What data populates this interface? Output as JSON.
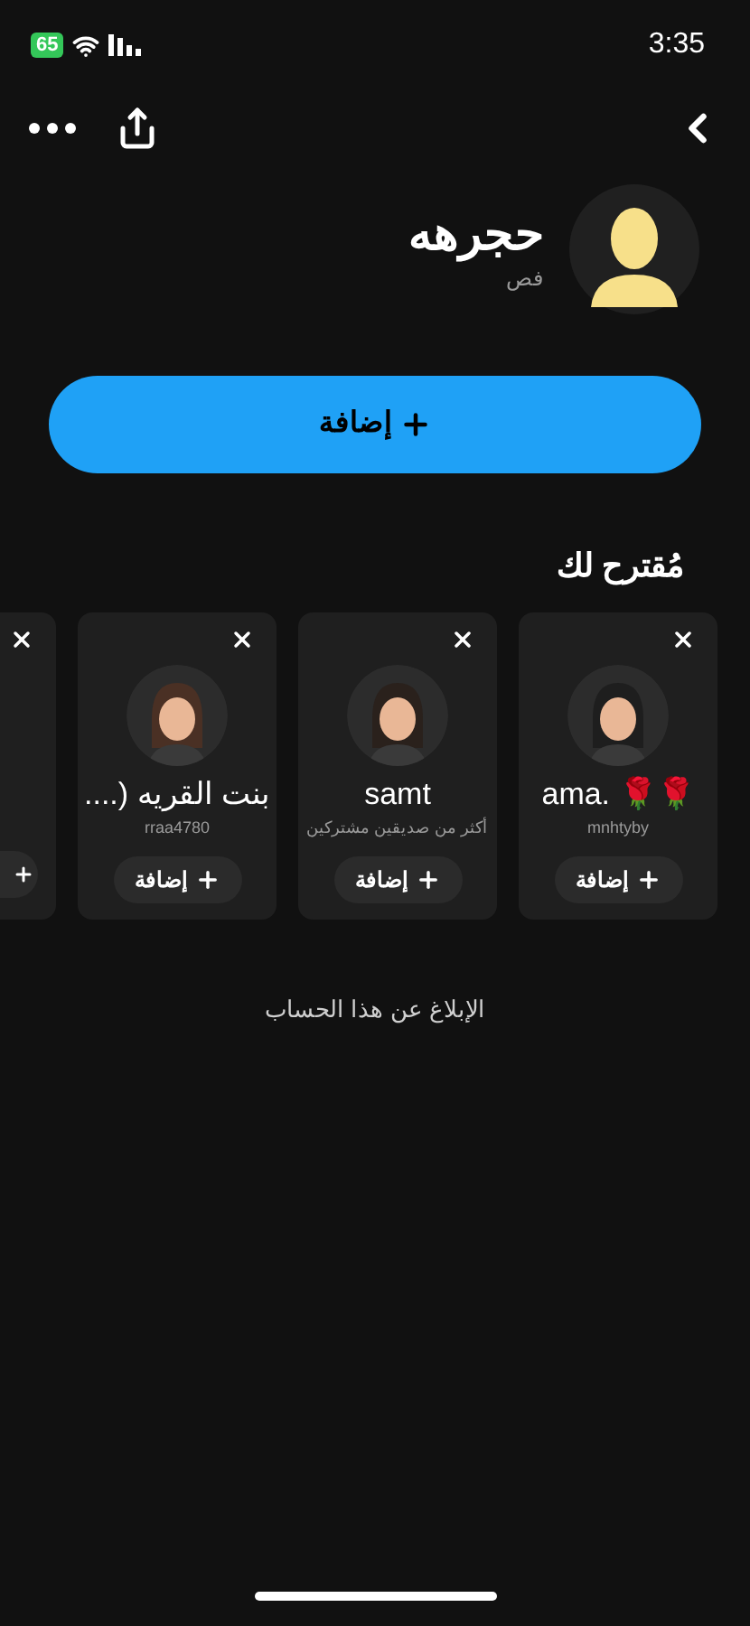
{
  "status_bar": {
    "time": "3:35",
    "battery": "65"
  },
  "profile": {
    "name": "حجرهه",
    "username": "فص"
  },
  "add_button": {
    "label": "إضافة"
  },
  "suggestions": {
    "title": "مُقترح لك",
    "cards": [
      {
        "kind": "full",
        "name": "ama. 🌹🌹",
        "subtitle": "mnhtyby",
        "button": "إضافة"
      },
      {
        "kind": "full",
        "name": "samt",
        "subtitle": "أكثر من صديقين مشتركين",
        "button": "إضافة"
      },
      {
        "kind": "full",
        "name": "بنت القريه (....",
        "subtitle": "rraa4780",
        "button": "إضافة"
      },
      {
        "kind": "partial"
      }
    ]
  },
  "report_link": "الإبلاغ عن هذا الحساب"
}
